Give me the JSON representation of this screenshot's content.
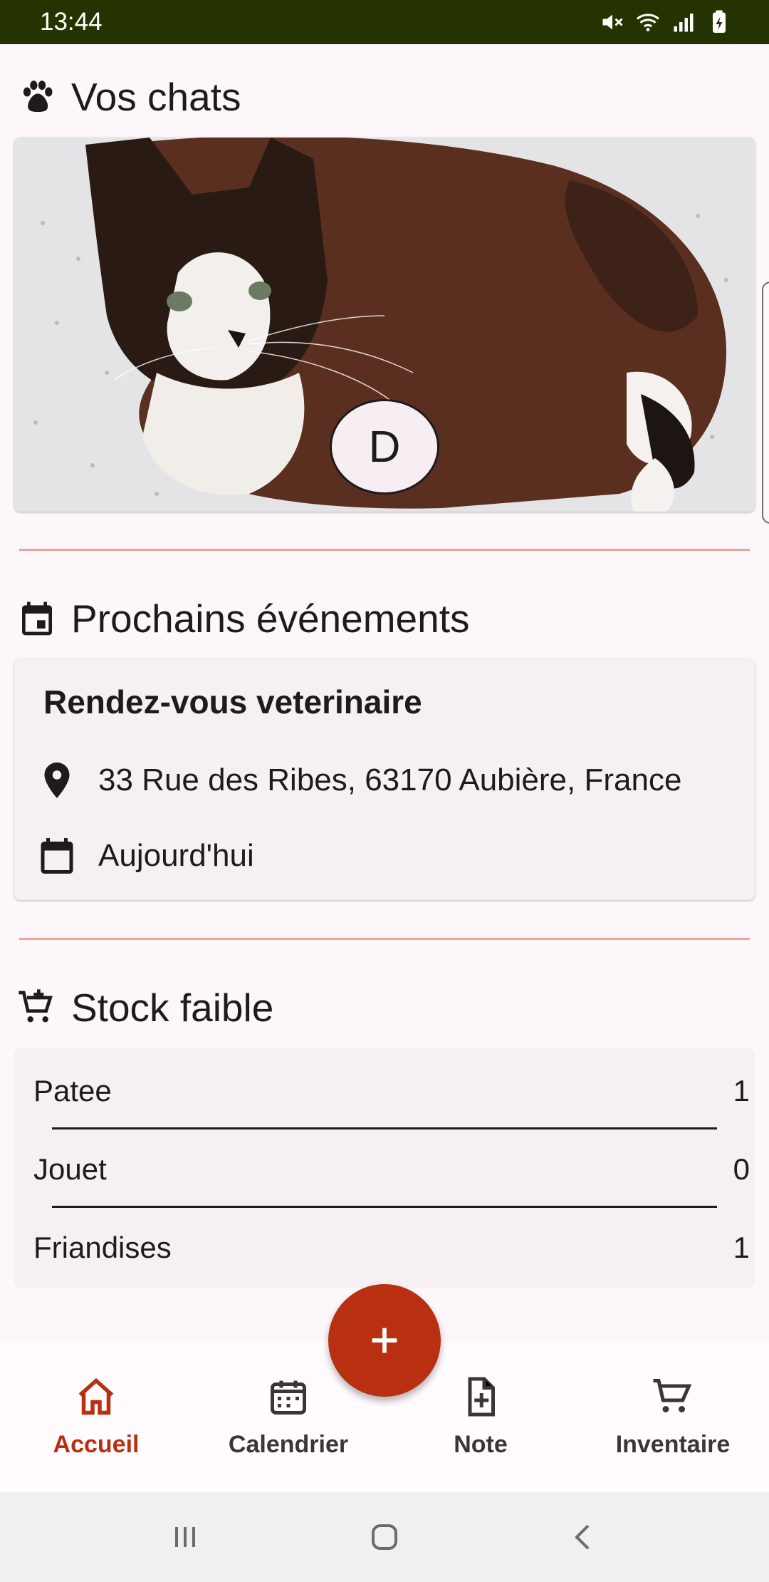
{
  "status_bar": {
    "time": "13:44"
  },
  "cats": {
    "title": "Vos chats",
    "avatar_initial": "D"
  },
  "events": {
    "title": "Prochains événements",
    "item": {
      "title": "Rendez-vous veterinaire",
      "address": "33 Rue des Ribes, 63170 Aubière, France",
      "date": "Aujourd'hui"
    }
  },
  "stock": {
    "title": "Stock faible",
    "items": [
      {
        "name": "Patee",
        "qty": "1"
      },
      {
        "name": "Jouet",
        "qty": "0"
      },
      {
        "name": "Friandises",
        "qty": "1"
      }
    ]
  },
  "fab": {
    "icon": "plus-icon"
  },
  "bottom_nav": {
    "items": [
      {
        "label": "Accueil",
        "icon": "home-icon",
        "active": true
      },
      {
        "label": "Calendrier",
        "icon": "calendar-icon"
      },
      {
        "label": "Note",
        "icon": "note-add-icon"
      },
      {
        "label": "Inventaire",
        "icon": "cart-icon"
      }
    ]
  },
  "colors": {
    "accent": "#b8300f",
    "status_bar": "#253300",
    "divider": "#e8a796",
    "background": "#fdf7fb"
  }
}
